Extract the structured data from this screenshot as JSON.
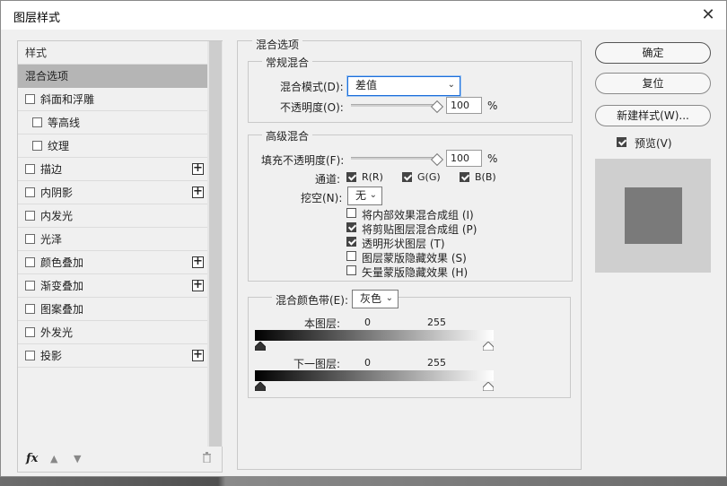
{
  "dialog": {
    "title": "图层样式",
    "close": "✕"
  },
  "styles": {
    "header": "样式",
    "items": [
      {
        "label": "混合选项",
        "selected": true,
        "checkbox": false,
        "plus": false,
        "indent": false
      },
      {
        "label": "斜面和浮雕",
        "checkbox": true,
        "plus": false,
        "indent": false
      },
      {
        "label": "等高线",
        "checkbox": true,
        "plus": false,
        "indent": true
      },
      {
        "label": "纹理",
        "checkbox": true,
        "plus": false,
        "indent": true
      },
      {
        "label": "描边",
        "checkbox": true,
        "plus": true,
        "indent": false
      },
      {
        "label": "内阴影",
        "checkbox": true,
        "plus": true,
        "indent": false
      },
      {
        "label": "内发光",
        "checkbox": true,
        "plus": false,
        "indent": false
      },
      {
        "label": "光泽",
        "checkbox": true,
        "plus": false,
        "indent": false
      },
      {
        "label": "颜色叠加",
        "checkbox": true,
        "plus": true,
        "indent": false
      },
      {
        "label": "渐变叠加",
        "checkbox": true,
        "plus": true,
        "indent": false
      },
      {
        "label": "图案叠加",
        "checkbox": true,
        "plus": false,
        "indent": false
      },
      {
        "label": "外发光",
        "checkbox": true,
        "plus": false,
        "indent": false
      },
      {
        "label": "投影",
        "checkbox": true,
        "plus": true,
        "indent": false
      }
    ],
    "fx_label": "fx",
    "up_icon": "▲",
    "down_icon": "▼",
    "trash_icon": "🗑"
  },
  "blend": {
    "section_title": "混合选项",
    "general": {
      "title": "常规混合",
      "mode_label": "混合模式(D):",
      "mode_value": "差值",
      "opacity_label": "不透明度(O):",
      "opacity_value": "100",
      "opacity_unit": "%"
    },
    "advanced": {
      "title": "高级混合",
      "fill_label": "填充不透明度(F):",
      "fill_value": "100",
      "fill_unit": "%",
      "channels_label": "通道:",
      "channel_r": "R(R)",
      "channel_g": "G(G)",
      "channel_b": "B(B)",
      "knockout_label": "挖空(N):",
      "knockout_value": "无",
      "options": [
        {
          "label": "将内部效果混合成组 (I)",
          "checked": false
        },
        {
          "label": "将剪贴图层混合成组 (P)",
          "checked": true
        },
        {
          "label": "透明形状图层 (T)",
          "checked": true
        },
        {
          "label": "图层蒙版隐藏效果 (S)",
          "checked": false
        },
        {
          "label": "矢量蒙版隐藏效果 (H)",
          "checked": false
        }
      ]
    },
    "blend_if": {
      "label": "混合颜色带(E):",
      "value": "灰色",
      "this_layer_label": "本图层:",
      "this_layer_low": "0",
      "this_layer_high": "255",
      "under_layer_label": "下一图层:",
      "under_layer_low": "0",
      "under_layer_high": "255"
    }
  },
  "buttons": {
    "ok": "确定",
    "reset": "复位",
    "new_style": "新建样式(W)...",
    "preview_label": "预览(V)"
  }
}
